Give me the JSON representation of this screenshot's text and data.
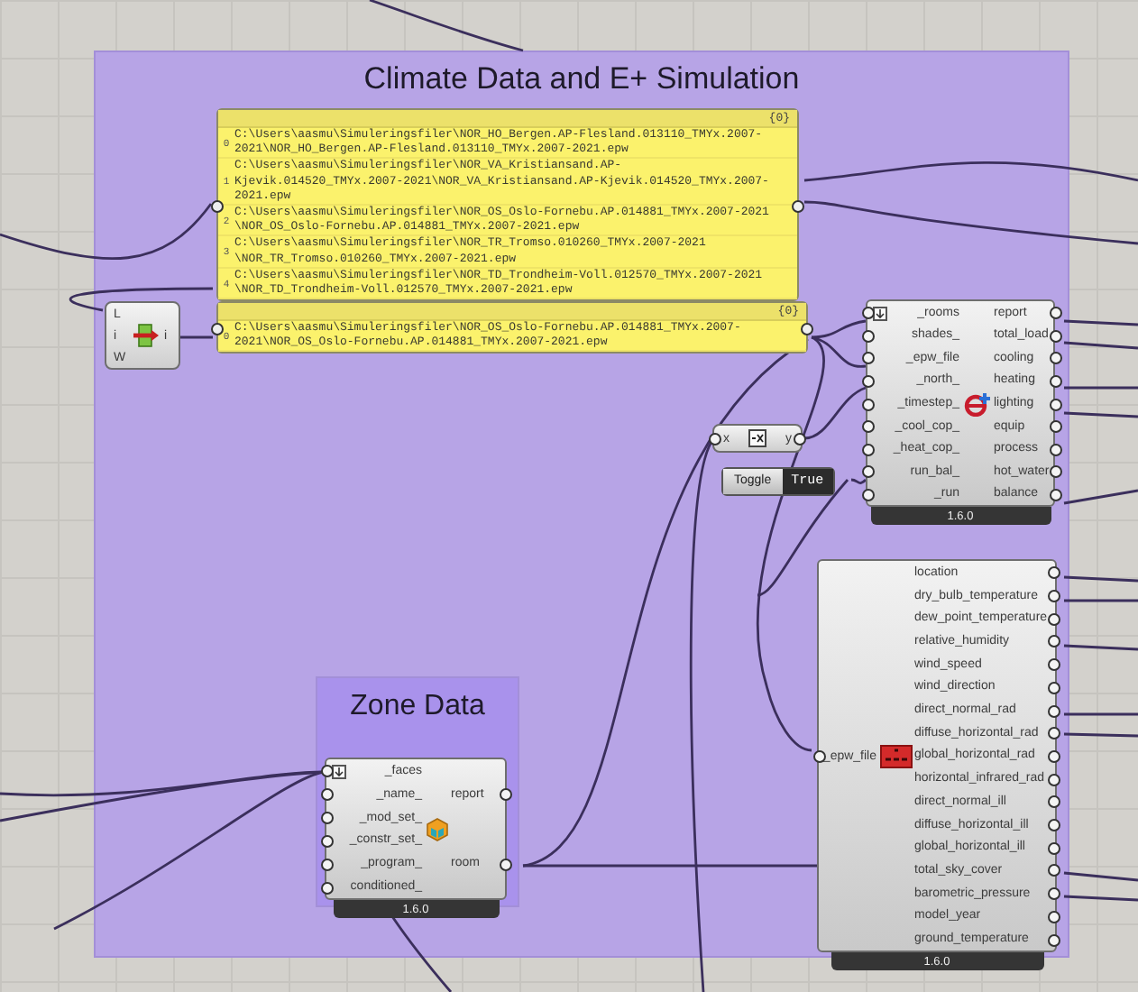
{
  "groups": [
    {
      "title": "Climate Data and E+ Simulation"
    },
    {
      "title": "Zone Data"
    }
  ],
  "panels": [
    {
      "header": "{0}",
      "items": [
        {
          "index": "0",
          "lines": [
            "C:\\Users\\aasmu\\Simuleringsfiler\\NOR_HO_Bergen.AP-Flesland.013110_TMYx.2007-",
            "2021\\NOR_HO_Bergen.AP-Flesland.013110_TMYx.2007-2021.epw"
          ]
        },
        {
          "index": "1",
          "lines": [
            "C:\\Users\\aasmu\\Simuleringsfiler\\NOR_VA_Kristiansand.AP-",
            "Kjevik.014520_TMYx.2007-2021\\NOR_VA_Kristiansand.AP-Kjevik.014520_TMYx.2007-",
            "2021.epw"
          ]
        },
        {
          "index": "2",
          "lines": [
            "C:\\Users\\aasmu\\Simuleringsfiler\\NOR_OS_Oslo-Fornebu.AP.014881_TMYx.2007-2021",
            "\\NOR_OS_Oslo-Fornebu.AP.014881_TMYx.2007-2021.epw"
          ]
        },
        {
          "index": "3",
          "lines": [
            "C:\\Users\\aasmu\\Simuleringsfiler\\NOR_TR_Tromso.010260_TMYx.2007-2021",
            "\\NOR_TR_Tromso.010260_TMYx.2007-2021.epw"
          ]
        },
        {
          "index": "4",
          "lines": [
            "C:\\Users\\aasmu\\Simuleringsfiler\\NOR_TD_Trondheim-Voll.012570_TMYx.2007-2021",
            "\\NOR_TD_Trondheim-Voll.012570_TMYx.2007-2021.epw"
          ]
        }
      ]
    },
    {
      "header": "{0}",
      "items": [
        {
          "index": "0",
          "lines": [
            "C:\\Users\\aasmu\\Simuleringsfiler\\NOR_OS_Oslo-Fornebu.AP.014881_TMYx.2007-",
            "2021\\NOR_OS_Oslo-Fornebu.AP.014881_TMYx.2007-2021.epw"
          ]
        }
      ]
    }
  ],
  "list_item": {
    "inputs": [
      "L",
      "i",
      "W"
    ],
    "outputs": [
      "i"
    ]
  },
  "expression": {
    "input": "x",
    "output": "y"
  },
  "toggle": {
    "label": "Toggle",
    "value": "True"
  },
  "components": [
    {
      "kind": "energy",
      "inputs": [
        "_rooms",
        "shades_",
        "_epw_file",
        "_north_",
        "_timestep_",
        "_cool_cop_",
        "_heat_cop_",
        "run_bal_",
        "_run"
      ],
      "outputs": [
        "report",
        "total_load",
        "cooling",
        "heating",
        "lighting",
        "equip",
        "process",
        "hot_water",
        "balance"
      ],
      "version": "1.6.0"
    },
    {
      "kind": "weather",
      "inputs": [
        "_epw_file"
      ],
      "outputs": [
        "location",
        "dry_bulb_temperature",
        "dew_point_temperature",
        "relative_humidity",
        "wind_speed",
        "wind_direction",
        "direct_normal_rad",
        "diffuse_horizontal_rad",
        "global_horizontal_rad",
        "horizontal_infrared_rad",
        "direct_normal_ill",
        "diffuse_horizontal_ill",
        "global_horizontal_ill",
        "total_sky_cover",
        "barometric_pressure",
        "model_year",
        "ground_temperature"
      ],
      "version": "1.6.0"
    },
    {
      "kind": "zone",
      "inputs": [
        "_faces",
        "_name_",
        "_mod_set_",
        "_constr_set_",
        "_program_",
        "conditioned_"
      ],
      "outputs": [
        "report",
        "room"
      ],
      "version": "1.6.0"
    }
  ]
}
